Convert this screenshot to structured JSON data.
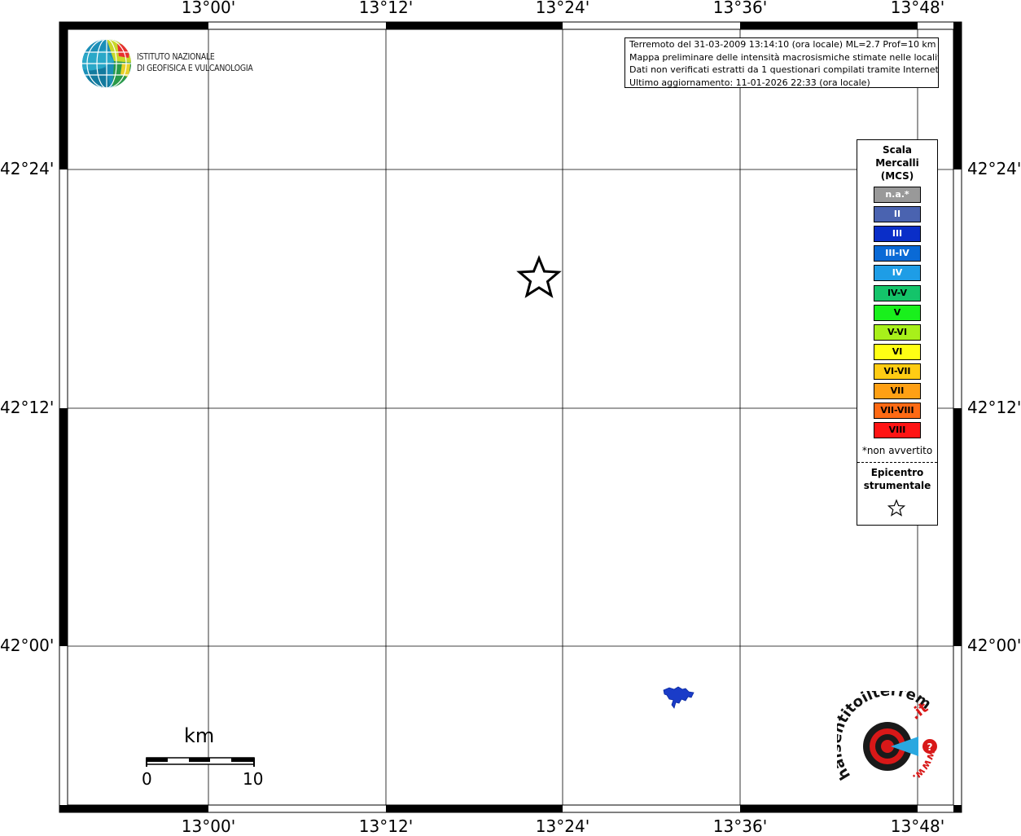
{
  "map": {
    "top_labels": [
      "13°00'",
      "13°12'",
      "13°24'",
      "13°36'",
      "13°48'"
    ],
    "bottom_labels": [
      "13°00'",
      "13°12'",
      "13°24'",
      "13°36'",
      "13°48'"
    ],
    "left_labels": [
      "42°24'",
      "42°12'",
      "42°00'"
    ],
    "right_labels": [
      "42°24'",
      "42°12'",
      "42°00'"
    ]
  },
  "logo": {
    "line1": "ISTITUTO NAZIONALE",
    "line2": "DI GEOFISICA E VULCANOLOGIA"
  },
  "info": {
    "line1": "Terremoto del 31-03-2009 13:14:10 (ora locale) ML=2.7 Prof=10 km",
    "line2": "Mappa preliminare delle intensità macrosismiche stimate nelle località",
    "line3": "Dati non verificati estratti da 1 questionari compilati tramite Internet.",
    "line4": "Ultimo aggiornamento: 11-01-2026 22:33 (ora locale)"
  },
  "legend": {
    "title1": "Scala",
    "title2": "Mercalli",
    "title3": "(MCS)",
    "items": [
      {
        "label": "n.a.*",
        "color": "#999999",
        "text_color": "#ffffff"
      },
      {
        "label": "II",
        "color": "#4a63b0",
        "text_color": "#ffffff"
      },
      {
        "label": "III",
        "color": "#0a2ec8",
        "text_color": "#ffffff"
      },
      {
        "label": "III-IV",
        "color": "#0a6ad6",
        "text_color": "#ffffff"
      },
      {
        "label": "IV",
        "color": "#1e9de6",
        "text_color": "#ffffff"
      },
      {
        "label": "IV-V",
        "color": "#14c46a",
        "text_color": "#000000"
      },
      {
        "label": "V",
        "color": "#19f01c",
        "text_color": "#000000"
      },
      {
        "label": "V-VI",
        "color": "#a8f01a",
        "text_color": "#000000"
      },
      {
        "label": "VI",
        "color": "#ffff14",
        "text_color": "#000000"
      },
      {
        "label": "VI-VII",
        "color": "#ffcc14",
        "text_color": "#000000"
      },
      {
        "label": "VII",
        "color": "#ffa014",
        "text_color": "#000000"
      },
      {
        "label": "VII-VIII",
        "color": "#ff6a14",
        "text_color": "#000000"
      },
      {
        "label": "VIII",
        "color": "#ff1414",
        "text_color": "#000000"
      }
    ],
    "note": "*non avvertito",
    "epi1": "Epicentro",
    "epi2": "strumentale"
  },
  "scale_bar": {
    "unit": "km",
    "start": "0",
    "end": "10"
  },
  "watermark": {
    "text_black": "haisentitoilterremoto",
    "text_red": ".it",
    "prefix": "www."
  }
}
